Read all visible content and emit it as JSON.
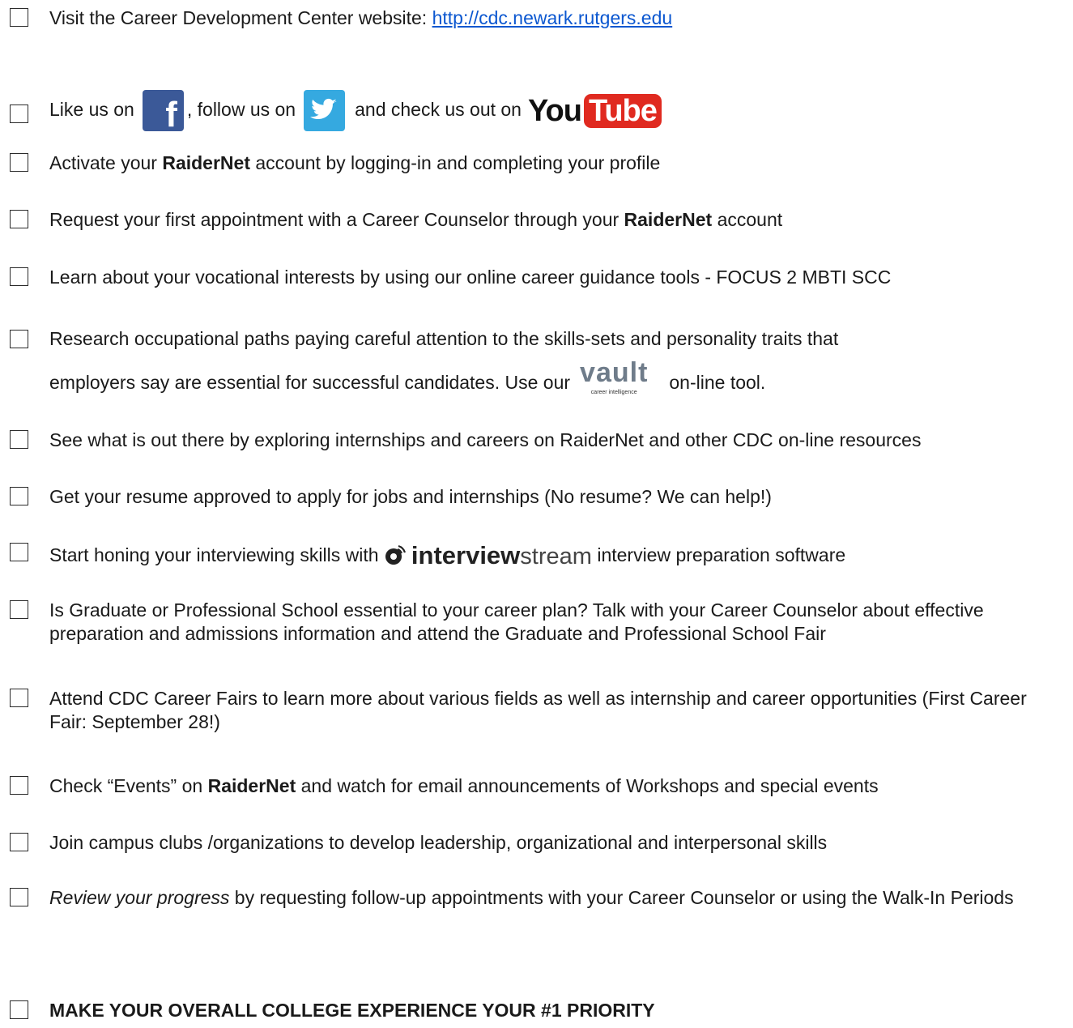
{
  "items": [
    {
      "pre": "Visit the Career Development Center website: ",
      "link": "http://cdc.newark.rutgers.edu"
    },
    {
      "like": "Like us on",
      "follow": ", follow us on",
      "check": "and check us out on",
      "youtube_you": "You",
      "youtube_tube": "Tube"
    },
    {
      "pre": "Activate your ",
      "bold": "RaiderNet",
      "post": " account by logging-in and completing your profile"
    },
    {
      "pre": "Request your first appointment with a Career Counselor through your ",
      "bold": "RaiderNet",
      "post": " account"
    },
    {
      "text": "Learn about your vocational interests by using our online career guidance tools - FOCUS 2  MBTI   SCC"
    },
    {
      "line1": "Research occupational paths paying careful attention to the skills-sets and personality traits that",
      "line2_pre": "employers say are essential for successful candidates.   Use our",
      "vault": "vault",
      "vault_sub": "career intelligence",
      "line2_post": "on-line tool."
    },
    {
      "text": "See what is out there by exploring internships and careers on RaiderNet and other CDC on-line resources"
    },
    {
      "text": "Get your resume approved to apply for jobs and internships (No resume?  We can help!)"
    },
    {
      "pre": "Start honing your interviewing skills with",
      "logo_bold": "interview",
      "logo_light": "stream",
      "post": "interview preparation software"
    },
    {
      "text": "Is Graduate or Professional School essential to your career plan?  Talk with your Career Counselor about effective preparation and admissions information and attend the Graduate and Professional School Fair"
    },
    {
      "text": "Attend CDC Career Fairs to learn more about various fields as well as internship and career opportunities (First Career Fair:  September 28!)"
    },
    {
      "pre": "Check “Events” on ",
      "bold": "RaiderNet",
      "post": " and watch for email announcements of Workshops and special events"
    },
    {
      "text": "Join campus clubs /organizations to develop leadership, organizational and interpersonal skills"
    },
    {
      "italic": "Review your progress",
      "post": " by requesting follow-up appointments with your Career Counselor or using the Walk-In Periods"
    },
    {
      "bold": "MAKE YOUR OVERALL COLLEGE EXPERIENCE YOUR #1 PRIORITY"
    }
  ]
}
